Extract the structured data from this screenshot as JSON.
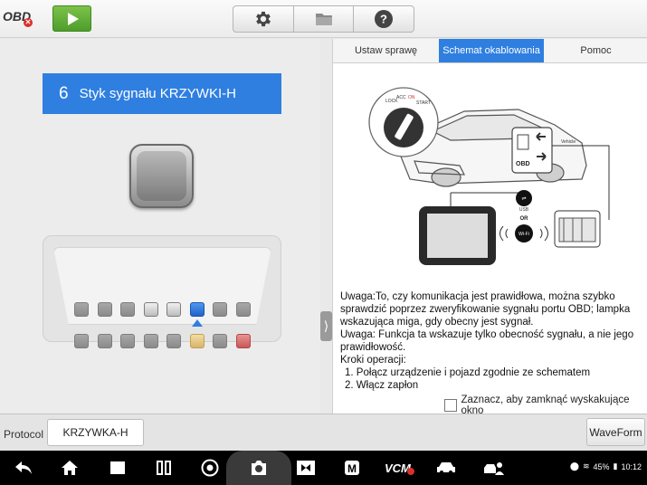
{
  "topbar": {
    "logo_text": "OBD",
    "icons": [
      "play-icon",
      "gear-icon",
      "folder-icon",
      "help-icon"
    ]
  },
  "left": {
    "pin_number": "6",
    "pin_title": "Styk sygnału KRZYWKI-H",
    "selected_pin": 5,
    "pins_top": [
      "dark",
      "dark",
      "dark",
      "light",
      "light",
      "blue",
      "dark",
      "dark"
    ],
    "pins_bottom": [
      "dark",
      "dark",
      "dark",
      "dark",
      "dark",
      "yellow",
      "dark",
      "red"
    ]
  },
  "tabs": [
    "Ustaw sprawę",
    "Schemat okablowania",
    "Pomoc"
  ],
  "active_tab": 1,
  "diagram": {
    "vehicle_label": "Vehicle",
    "obd_label": "OBD",
    "usb_label": "USB",
    "or_label": "OR",
    "wifi_label": "Wi-Fi",
    "ignition_labels": [
      "LOCK",
      "ACC",
      "ON",
      "START"
    ]
  },
  "note": {
    "line1": "Uwaga:To, czy komunikacja jest prawidłowa, można szybko sprawdzić poprzez zweryfikowanie sygnału portu OBD; lampka wskazująca miga, gdy obecny jest sygnał.",
    "line2": "Uwaga: Funkcja ta wskazuje tylko obecność sygnału, a nie jego prawidłowość.",
    "steps_title": "Kroki operacji:",
    "step1": "1. Połącz urządzenie i pojazd zgodnie ze schematem",
    "step2": "2. Włącz zapłon"
  },
  "close_popup_label": "Zaznacz, aby zamknąć wyskakujące okno",
  "bottom": {
    "protocol_label": "Protocol",
    "protocol_value": "KRZYWKA-H",
    "waveform_label": "WaveForm"
  },
  "status": {
    "battery": "45%",
    "time": "10:12"
  },
  "colors": {
    "accent": "#2f7fe0",
    "play_green": "#5aa834"
  }
}
